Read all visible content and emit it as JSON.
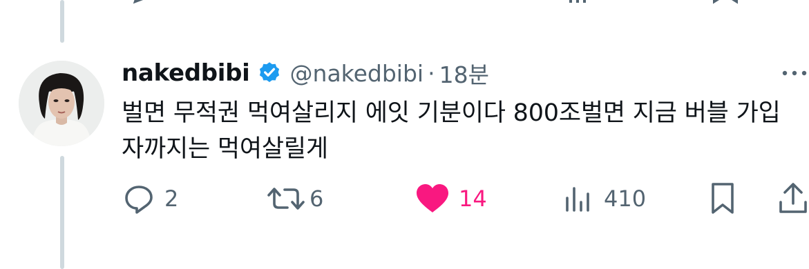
{
  "tweet": {
    "display_name": "nakedbibi",
    "handle": "@nakedbibi",
    "separator": "·",
    "time": "18분",
    "content": "벌면 무적권 먹여살리지 에잇 기분이다 800조벌면 지금 버블 가입자까지는 먹여살릴게"
  },
  "actions": {
    "reply_count": "2",
    "retweet_count": "6",
    "like_count": "14",
    "view_count": "410"
  },
  "icons": {
    "verified": "verified-badge-icon",
    "more": "more-icon",
    "reply": "reply-icon",
    "retweet": "retweet-icon",
    "like": "heart-icon",
    "views": "views-icon",
    "bookmark": "bookmark-icon",
    "share": "share-icon"
  },
  "colors": {
    "verified_blue": "#1d9bf0",
    "like_pink": "#f91880",
    "secondary_text": "#536471",
    "thread_line": "#cfd9de"
  }
}
